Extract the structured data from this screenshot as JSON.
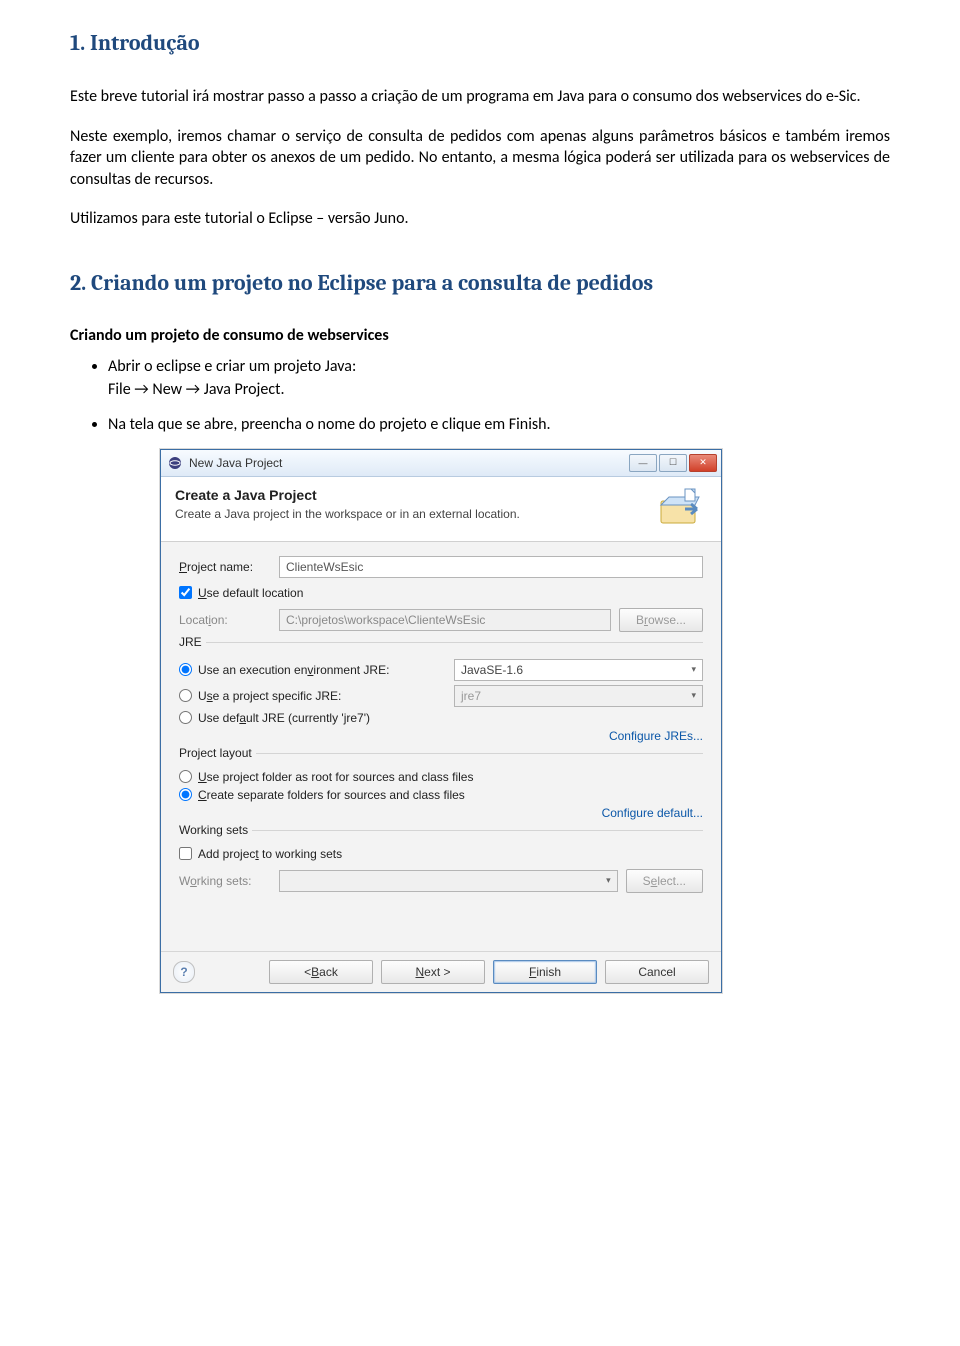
{
  "doc": {
    "heading1": "1. Introdução",
    "p1": "Este breve tutorial irá mostrar passo a passo a criação de um programa em Java para o consumo dos webservices do e-Sic.",
    "p2": "Neste exemplo, iremos chamar o serviço de consulta de pedidos com apenas alguns parâmetros básicos e também iremos fazer um cliente para obter os anexos de um pedido. No entanto, a mesma lógica poderá ser utilizada para os webservices de consultas de recursos.",
    "p3": "Utilizamos para este tutorial o Eclipse – versão Juno.",
    "heading2": "2. Criando um projeto no Eclipse para a consulta de pedidos",
    "subhead": "Criando um projeto de consumo de webservices",
    "bullet1a": "Abrir o eclipse e criar um projeto Java:",
    "bullet1b": "File → New → Java Project.",
    "bullet2": "Na tela que se abre, preencha o nome do projeto e clique em Finish."
  },
  "dialog": {
    "title": "New Java Project",
    "banner_title": "Create a Java Project",
    "banner_sub": "Create a Java project in the workspace or in an external location.",
    "project_name_label": "Project name:",
    "project_name_value": "ClienteWsEsic",
    "use_default_location": "Use default location",
    "location_label": "Location:",
    "location_value": "C:\\projetos\\workspace\\ClienteWsEsic",
    "browse": "Browse...",
    "jre_group": "JRE",
    "jre_opt1": "Use an execution environment JRE:",
    "jre_opt1_value": "JavaSE-1.6",
    "jre_opt2": "Use a project specific JRE:",
    "jre_opt2_value": "jre7",
    "jre_opt3": "Use default JRE (currently 'jre7')",
    "configure_jres": "Configure JREs...",
    "layout_group": "Project layout",
    "layout_opt1": "Use project folder as root for sources and class files",
    "layout_opt2": "Create separate folders for sources and class files",
    "configure_default": "Configure default...",
    "ws_group": "Working sets",
    "ws_check": "Add project to working sets",
    "ws_label": "Working sets:",
    "select": "Select...",
    "back": "< Back",
    "next": "Next >",
    "finish": "Finish",
    "cancel": "Cancel"
  }
}
